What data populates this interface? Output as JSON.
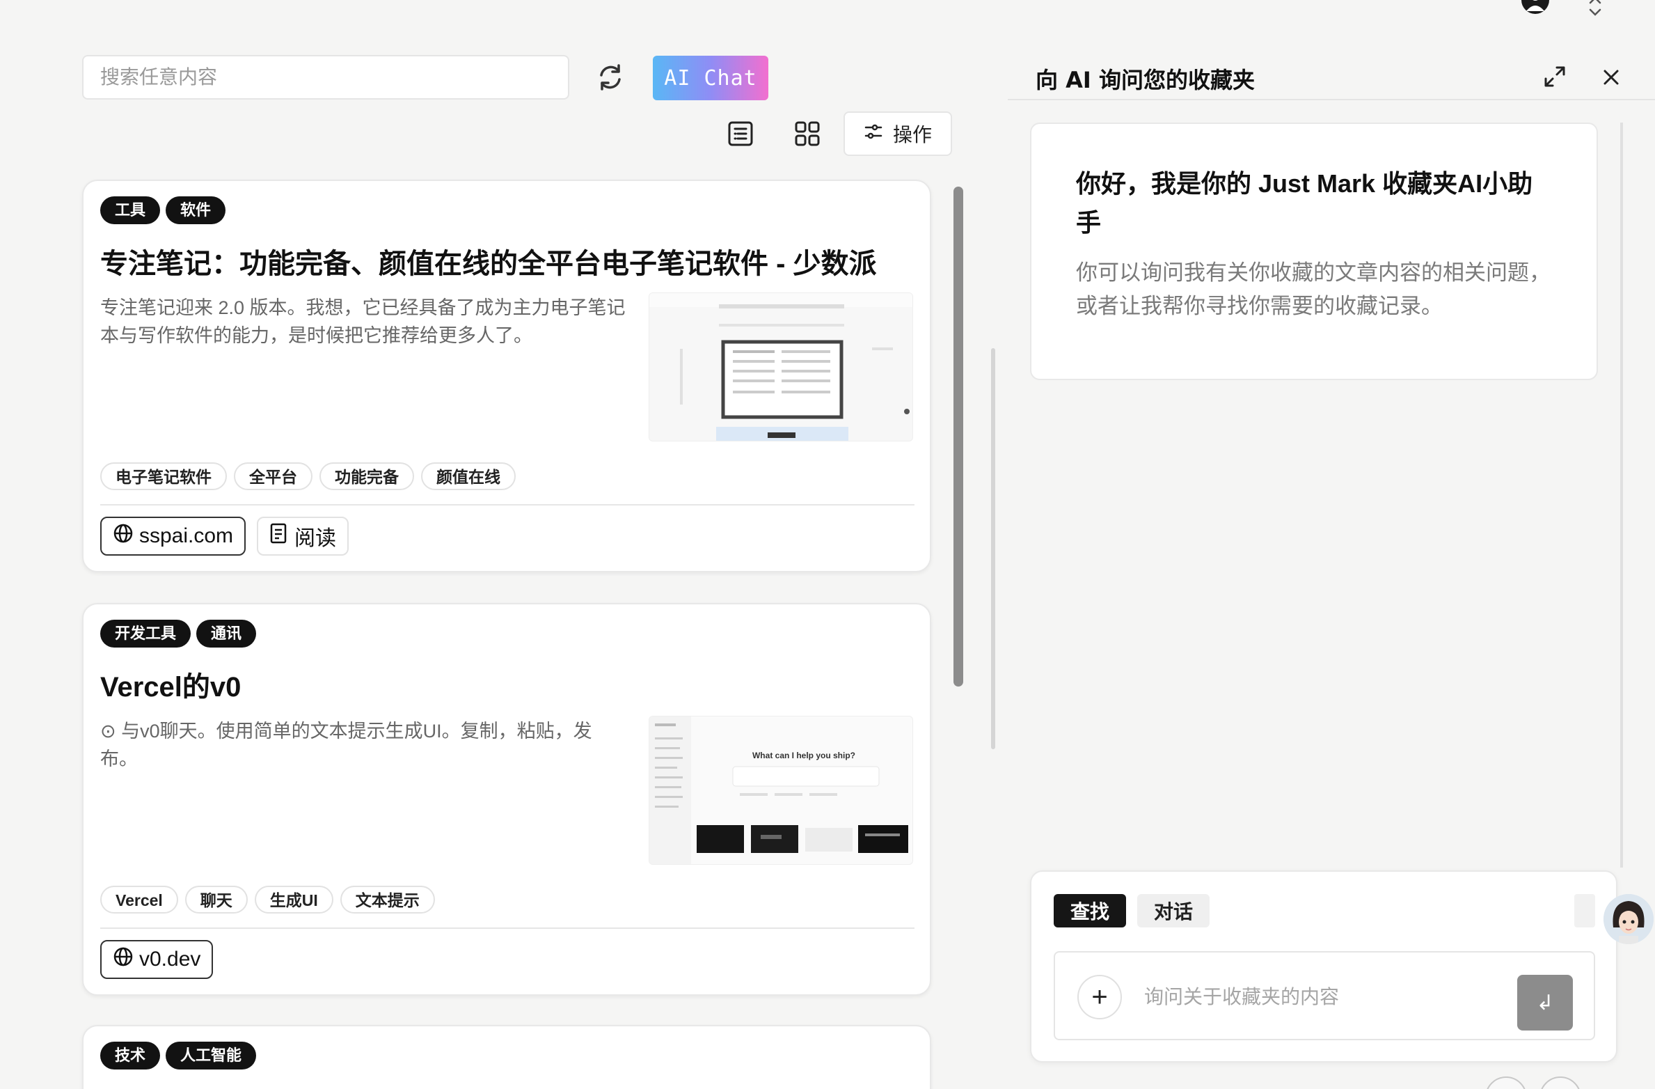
{
  "toolbar": {
    "search_placeholder": "搜索任意内容",
    "ai_chat_label": "AI Chat",
    "actions_label": "操作"
  },
  "bookmarks": [
    {
      "categories": [
        "工具",
        "软件"
      ],
      "title": "专注笔记：功能完备、颜值在线的全平台电子笔记软件 - 少数派",
      "description": "专注笔记迎来 2.0 版本。我想，它已经具备了成为主力电子笔记本与写作软件的能力，是时候把它推荐给更多人了。",
      "keywords": [
        "电子笔记软件",
        "全平台",
        "功能完备",
        "颜值在线"
      ],
      "domain": "sspai.com",
      "read_label": "阅读"
    },
    {
      "categories": [
        "开发工具",
        "通讯"
      ],
      "title": "Vercel的v0",
      "description": "⊙ 与v0聊天。使用简单的文本提示生成UI。复制，粘贴，发布。",
      "keywords": [
        "Vercel",
        "聊天",
        "生成UI",
        "文本提示"
      ],
      "domain": "v0.dev",
      "thumb_heading": "What can I help you ship?"
    },
    {
      "categories": [
        "技术",
        "人工智能"
      ]
    }
  ],
  "chat_panel": {
    "title": "向 AI 询问您的收藏夹",
    "intro_title": "你好，我是你的 Just Mark 收藏夹AI小助手",
    "intro_text": "你可以询问我有关你收藏的文章内容的相关问题，或者让我帮你寻找你需要的收藏记录。",
    "tabs": [
      "查找",
      "对话"
    ],
    "active_tab": "查找",
    "input_placeholder": "询问关于收藏夹的内容",
    "plus_label": "+",
    "send_label": "↲"
  },
  "colors": {
    "background": "#f5f5f4",
    "badge": "#121212",
    "ai_chat_gradient_start": "#5ab7f5",
    "ai_chat_gradient_end": "#f26fcf",
    "send_button": "#8c8c8c"
  }
}
